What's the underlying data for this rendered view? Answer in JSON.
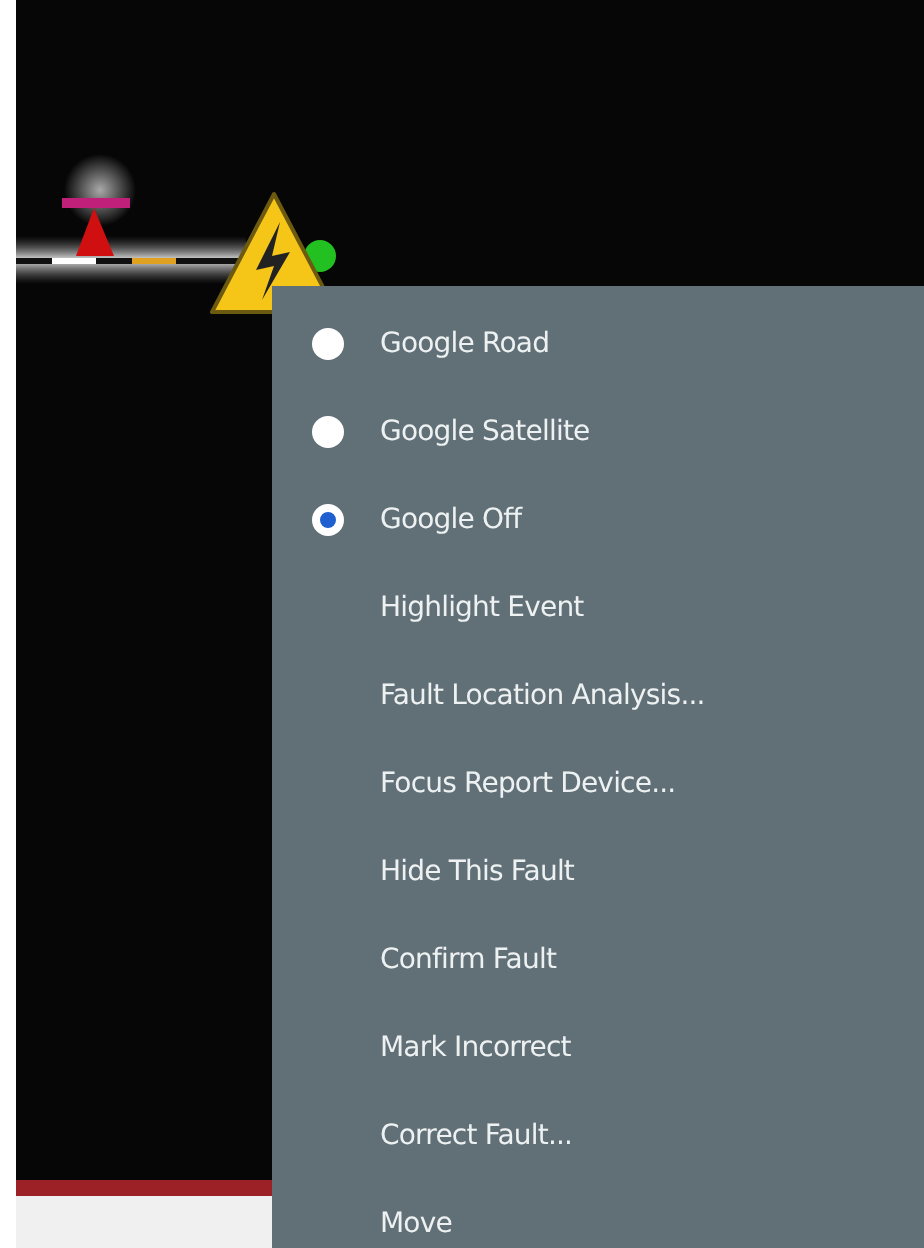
{
  "context_menu": {
    "items": [
      {
        "kind": "radio",
        "label": "Google Road",
        "selected": false
      },
      {
        "kind": "radio",
        "label": "Google Satellite",
        "selected": false
      },
      {
        "kind": "radio",
        "label": "Google Off",
        "selected": true
      },
      {
        "kind": "command",
        "label": "Highlight Event"
      },
      {
        "kind": "command",
        "label": "Fault Location Analysis..."
      },
      {
        "kind": "command",
        "label": "Focus Report Device..."
      },
      {
        "kind": "command",
        "label": "Hide This Fault"
      },
      {
        "kind": "command",
        "label": "Confirm Fault"
      },
      {
        "kind": "command",
        "label": "Mark Incorrect"
      },
      {
        "kind": "command",
        "label": "Correct Fault..."
      },
      {
        "kind": "command",
        "label": "Move"
      }
    ]
  }
}
